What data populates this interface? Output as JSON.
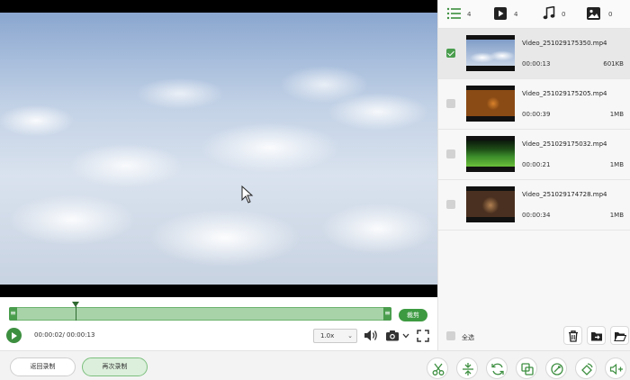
{
  "player": {
    "crop_label": "裁剪",
    "time_display": "00:00:02/ 00:00:13",
    "playback_progress_fraction": 0.16,
    "speed": "1.0x"
  },
  "bottom_bar": {
    "back_label": "返回录制",
    "record_again_label": "再次录制",
    "tools": [
      "scissors-icon",
      "split-icon",
      "convert-icon",
      "compress-icon",
      "watermark-icon",
      "rotate-icon",
      "volume-plus-icon"
    ]
  },
  "tabs": [
    {
      "icon": "list-icon",
      "count": "4"
    },
    {
      "icon": "video-icon",
      "count": "4"
    },
    {
      "icon": "music-icon",
      "count": "0"
    },
    {
      "icon": "image-icon",
      "count": "0"
    }
  ],
  "files": [
    {
      "name": "Video_251029175350.mp4",
      "duration": "00:00:13",
      "size": "601KB",
      "checked": true
    },
    {
      "name": "Video_251029175205.mp4",
      "duration": "00:00:39",
      "size": "1MB",
      "checked": false
    },
    {
      "name": "Video_251029175032.mp4",
      "duration": "00:00:21",
      "size": "1MB",
      "checked": false
    },
    {
      "name": "Video_251029174728.mp4",
      "duration": "00:00:34",
      "size": "1MB",
      "checked": false
    }
  ],
  "footer": {
    "select_all_label": "全选"
  },
  "colors": {
    "accent": "#3d9a41",
    "timeline_fill": "#a8d3a9"
  }
}
